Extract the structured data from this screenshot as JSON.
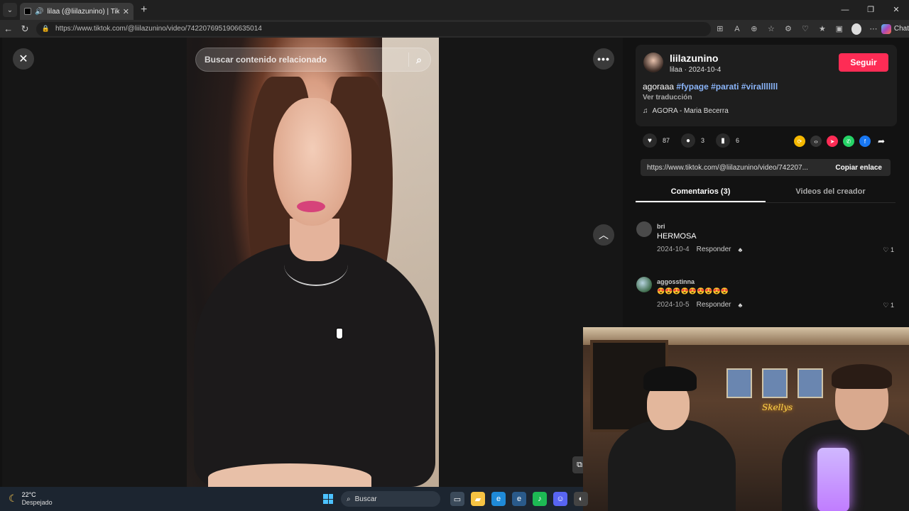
{
  "browser": {
    "tab_title": "lilaa (@liilazunino) | TikTok",
    "url": "https://www.tiktok.com/@liilazunino/video/7422076951906635014",
    "chat_label": "Chat"
  },
  "video": {
    "search_placeholder": "Buscar contenido relacionado"
  },
  "post": {
    "username": "liilazunino",
    "nick_date": "lilaa · 2024-10-4",
    "follow_label": "Seguir",
    "caption_text": "agoraaa",
    "hashtags": [
      "#fypage",
      "#parati",
      "#viralllllll"
    ],
    "translate_label": "Ver traducción",
    "music": "AGORA - Maria Becerra",
    "likes": "87",
    "comments": "3",
    "saves": "6",
    "share_link": "https://www.tiktok.com/@liilazunino/video/742207...",
    "copy_label": "Copiar enlace"
  },
  "tabs": {
    "comments": "Comentarios (3)",
    "creator_videos": "Videos del creador"
  },
  "comments": [
    {
      "user": "bri",
      "text": "HERMOSA",
      "date": "2024-10-4",
      "reply": "Responder",
      "likes": "1"
    },
    {
      "user": "aggosstinna",
      "text": "😍😍😍😍😍😍😍😍😍",
      "date": "2024-10-5",
      "reply": "Responder",
      "likes": "1"
    }
  ],
  "webcam": {
    "neon_text": "Skellys"
  },
  "taskbar": {
    "temp": "22°C",
    "condition": "Despejado",
    "search_label": "Buscar"
  },
  "colors": {
    "follow": "#fe2c55",
    "hashtag": "#8ab4f8"
  }
}
